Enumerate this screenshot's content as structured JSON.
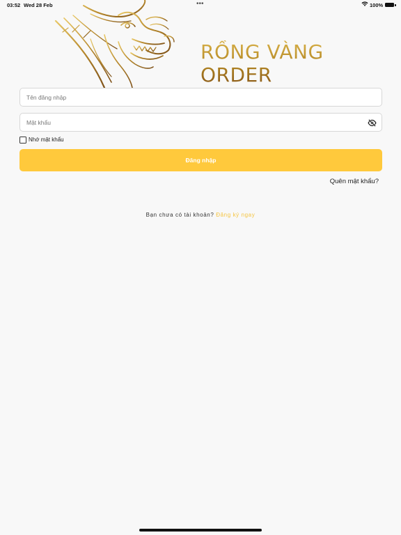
{
  "status_bar": {
    "time": "03:52",
    "date": "Wed 28 Feb",
    "multitask_dots": "•••",
    "battery_percent": "100%"
  },
  "brand": {
    "name": "RỒNG VÀNG ORDER",
    "logo": "golden-dragon-head",
    "gold_light": "#d9b24a",
    "gold_dark": "#8a5a1c"
  },
  "form": {
    "username_placeholder": "Tên đăng nhập",
    "username_value": "",
    "password_placeholder": "Mật khẩu",
    "password_value": "",
    "password_toggle_icon": "eye-slash-icon",
    "remember_label": "Nhớ mật khẩu",
    "remember_checked": false,
    "login_label": "Đăng nhập",
    "forgot_label": "Quên mật khẩu?"
  },
  "signup": {
    "prompt": "Bạn chưa có tài khoản?",
    "link_label": "Đăng ký ngay"
  },
  "colors": {
    "accent": "#ffc93c",
    "link": "#f5c542",
    "background": "#f8f8f8"
  }
}
